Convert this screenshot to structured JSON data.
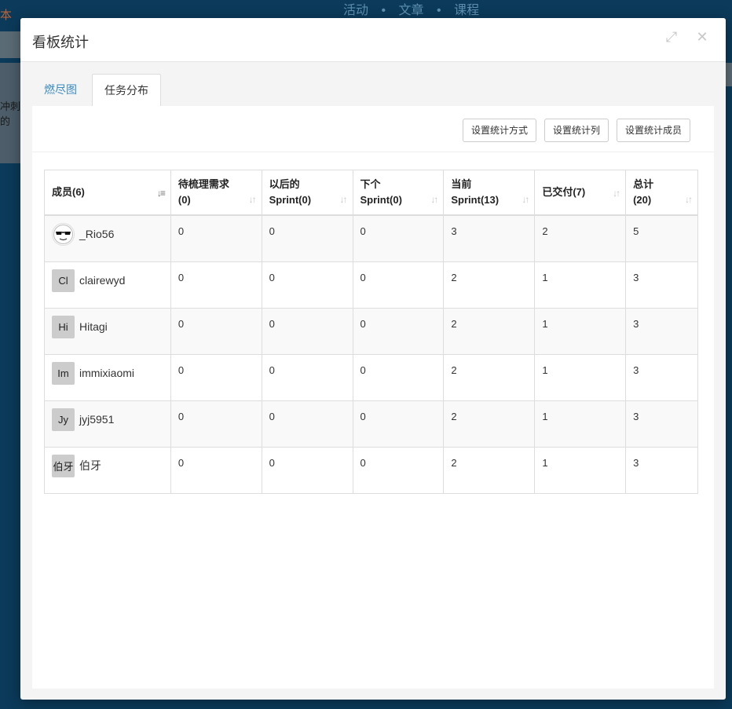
{
  "background": {
    "nav_items": [
      "活动",
      "文章",
      "课程"
    ],
    "left_text": "本",
    "left_fragment": "冲刺的"
  },
  "modal": {
    "title": "看板统计",
    "tabs": [
      {
        "label": "燃尽图",
        "active": false
      },
      {
        "label": "任务分布",
        "active": true
      }
    ],
    "toolbar": {
      "btn_mode": "设置统计方式",
      "btn_columns": "设置统计列",
      "btn_members": "设置统计成员"
    },
    "table": {
      "headers": [
        {
          "line1": "成员(6)",
          "line2": ""
        },
        {
          "line1": "待梳理需求",
          "line2": "(0)"
        },
        {
          "line1": "以后的",
          "line2": "Sprint(0)"
        },
        {
          "line1": "下个",
          "line2": "Sprint(0)"
        },
        {
          "line1": "当前",
          "line2": "Sprint(13)"
        },
        {
          "line1": "已交付(7)",
          "line2": ""
        },
        {
          "line1": "总计",
          "line2": "(20)"
        }
      ],
      "rows": [
        {
          "avatar": "",
          "avatar_icon": "sunglasses-face-icon",
          "name": "_Rio56",
          "values": [
            "0",
            "0",
            "0",
            "3",
            "2",
            "5"
          ]
        },
        {
          "avatar": "Cl",
          "name": "clairewyd",
          "values": [
            "0",
            "0",
            "0",
            "2",
            "1",
            "3"
          ]
        },
        {
          "avatar": "Hi",
          "name": "Hitagi",
          "values": [
            "0",
            "0",
            "0",
            "2",
            "1",
            "3"
          ]
        },
        {
          "avatar": "Im",
          "name": "immixiaomi",
          "values": [
            "0",
            "0",
            "0",
            "2",
            "1",
            "3"
          ]
        },
        {
          "avatar": "Jy",
          "name": "jyj5951",
          "values": [
            "0",
            "0",
            "0",
            "2",
            "1",
            "3"
          ]
        },
        {
          "avatar": "伯牙",
          "name": "伯牙",
          "values": [
            "0",
            "0",
            "0",
            "2",
            "1",
            "3"
          ]
        }
      ]
    }
  }
}
